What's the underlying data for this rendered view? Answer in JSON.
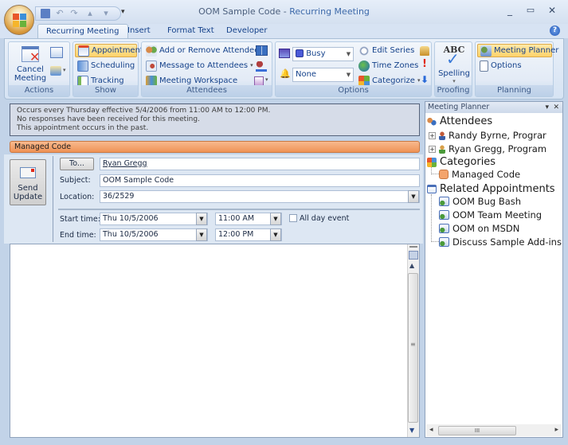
{
  "window": {
    "doc_title": "OOM Sample Code",
    "separator": " - ",
    "app_title": "Recurring Meeting",
    "minimize": "_",
    "maximize": "▭",
    "close": "✕"
  },
  "qat": {
    "save_icon": "save-icon",
    "undo_icon": "undo-icon",
    "redo_icon": "redo-icon",
    "prev_icon": "previous-item-icon",
    "next_icon": "next-item-icon",
    "customize": "▾"
  },
  "tabs": [
    {
      "label": "Recurring Meeting",
      "active": true
    },
    {
      "label": "Insert",
      "active": false
    },
    {
      "label": "Format Text",
      "active": false
    },
    {
      "label": "Developer",
      "active": false
    }
  ],
  "help": "?",
  "ribbon": {
    "actions": {
      "label": "Actions",
      "cancel_meeting": "Cancel\nMeeting",
      "cancel_line1": "Cancel",
      "cancel_line2": "Meeting"
    },
    "show": {
      "label": "Show",
      "appointment": "Appointment",
      "scheduling": "Scheduling",
      "tracking": "Tracking"
    },
    "attendees": {
      "label": "Attendees",
      "add_remove": "Add or Remove Attendees",
      "message": "Message to Attendees",
      "workspace": "Meeting Workspace"
    },
    "options": {
      "label": "Options",
      "show_as": "Busy",
      "reminder": "None",
      "edit_series": "Edit Series",
      "time_zones": "Time Zones",
      "categorize": "Categorize"
    },
    "proofing": {
      "label": "Proofing",
      "spelling": "Spelling",
      "abc": "ABC"
    },
    "planning": {
      "label": "Planning",
      "meeting_planner": "Meeting Planner",
      "options": "Options"
    }
  },
  "info": {
    "line1": "Occurs every Thursday effective 5/4/2006 from 11:00 AM to 12:00 PM.",
    "line2": "No responses have been received for this meeting.",
    "line3": "This appointment occurs in the past."
  },
  "category_bar": {
    "label": "Managed Code",
    "color": "#f4a46c"
  },
  "form": {
    "send_update_line1": "Send",
    "send_update_line2": "Update",
    "to_button": "To...",
    "to_value": "Ryan Gregg",
    "subject_label": "Subject:",
    "subject_value": "OOM Sample Code",
    "location_label": "Location:",
    "location_value": "36/2529",
    "start_label": "Start time:",
    "start_date": "Thu 10/5/2006",
    "start_time": "11:00 AM",
    "end_label": "End time:",
    "end_date": "Thu 10/5/2006",
    "end_time": "12:00 PM",
    "all_day_label": "All day event",
    "all_day_checked": false
  },
  "planner": {
    "title": "Meeting Planner",
    "dropdown": "▾",
    "close": "✕",
    "attendees_label": "Attendees",
    "attendees": [
      "Randy Byrne, Prograr",
      "Ryan Gregg, Program"
    ],
    "categories_label": "Categories",
    "categories": [
      "Managed Code"
    ],
    "related_label": "Related Appointments",
    "related": [
      "OOM Bug Bash",
      "OOM Team Meeting",
      "OOM on MSDN",
      "Discuss Sample Add-ins"
    ]
  },
  "scroll": {
    "grip": "≡",
    "hgrip": "III",
    "up": "▲",
    "down": "▼",
    "left": "◂",
    "right": "▸"
  }
}
